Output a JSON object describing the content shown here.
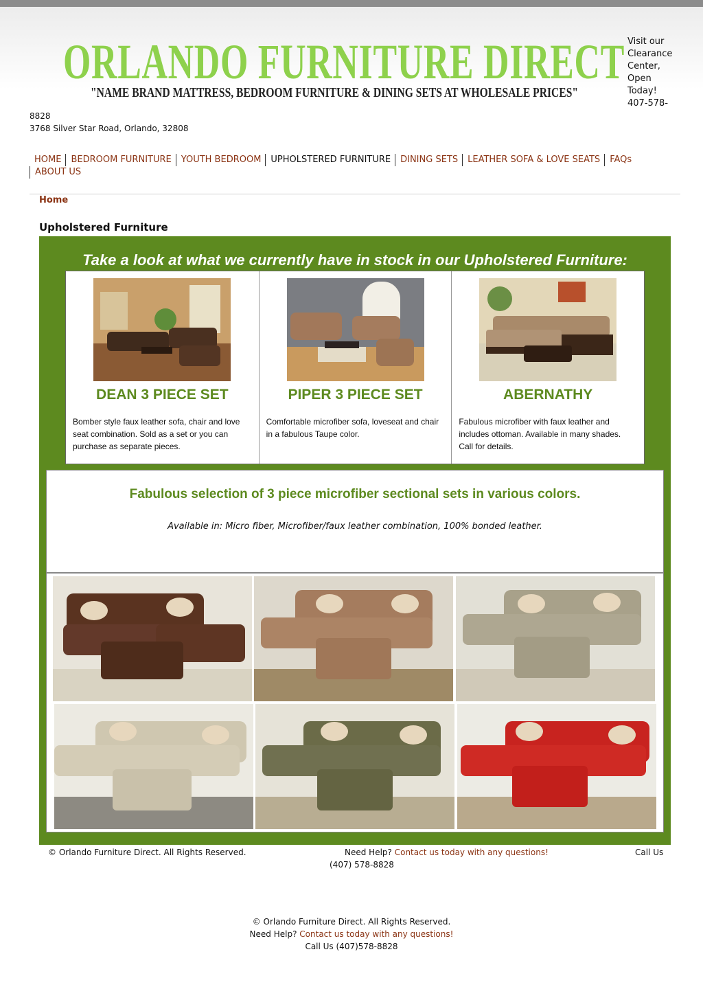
{
  "header": {
    "logo": "ORLANDO FURNITURE DIRECT",
    "tagline": "\"NAME BRAND MATTRESS, BEDROOM FURNITURE & DINING SETS AT WHOLESALE PRICES\"",
    "visit_lines": [
      "Visit our",
      "Clearance",
      "Center,",
      "Open",
      "Today!",
      "407-578-"
    ],
    "phone_tail": "8828",
    "address": "3768 Silver Star Road, Orlando, 32808"
  },
  "nav": {
    "items": [
      {
        "label": "HOME"
      },
      {
        "label": "BEDROOM FURNITURE"
      },
      {
        "label": "YOUTH BEDROOM"
      },
      {
        "label": "UPHOLSTERED FURNITURE"
      },
      {
        "label": "DINING SETS"
      },
      {
        "label": "LEATHER SOFA & LOVE SEATS"
      },
      {
        "label": "FAQs"
      },
      {
        "label": "ABOUT US"
      }
    ]
  },
  "breadcrumb": "Home",
  "page_title": "Upholstered Furniture",
  "stock_heading": "Take a look at what we currently have in stock in our Upholstered Furniture:",
  "products": [
    {
      "name": "DEAN 3 PIECE SET",
      "desc": "Bomber style faux leather sofa, chair and love seat combination. Sold as a set or you can purchase as separate pieces."
    },
    {
      "name": "PIPER 3 PIECE SET",
      "desc": "Comfortable microfiber sofa, loveseat and chair in a fabulous Taupe color."
    },
    {
      "name": "ABERNATHY",
      "desc": "Fabulous microfiber with faux leather and includes ottoman. Available in many shades. Call for details."
    }
  ],
  "selection": {
    "heading": "Fabulous selection of 3 piece microfiber sectional sets in various colors.",
    "available": "Available in: Micro fiber, Microfiber/faux leather combination, 100% bonded leather."
  },
  "colors": {
    "green": "#5d8a1f",
    "logo_green": "#8ed14c",
    "link": "#8b3414",
    "sofa_colors": [
      "#5a3320",
      "#a57c5e",
      "#a8a18a",
      "#cfc7b0",
      "#6b6b48",
      "#c8231f"
    ]
  },
  "footer": {
    "copyright": "© Orlando Furniture Direct. All Rights Reserved.",
    "need_help": "Need Help?",
    "contact_link": "Contact us today with any questions!",
    "call_us": "Call Us",
    "phone": "(407) 578-8828",
    "bottom_call": "Call Us (407)578-8828"
  }
}
